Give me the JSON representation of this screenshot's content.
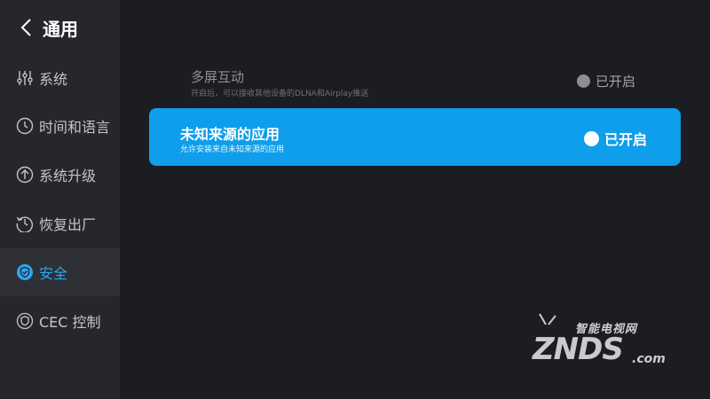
{
  "header": {
    "title": "通用"
  },
  "sidebar": {
    "items": [
      {
        "label": "系统",
        "icon": "sliders-icon"
      },
      {
        "label": "时间和语言",
        "icon": "clock-icon"
      },
      {
        "label": "系统升级",
        "icon": "upload-icon"
      },
      {
        "label": "恢复出厂",
        "icon": "restore-icon"
      },
      {
        "label": "安全",
        "icon": "shield-icon",
        "active": true
      },
      {
        "label": "CEC 控制",
        "icon": "cec-icon"
      }
    ]
  },
  "settings": [
    {
      "title": "多屏互动",
      "description": "开启后，可以接收其他设备的DLNA和Airplay推送",
      "status": "已开启",
      "focused": false
    },
    {
      "title": "未知来源的应用",
      "description": "允许安装来自未知来源的应用",
      "status": "已开启",
      "focused": true
    }
  ],
  "watermark": {
    "tagline": "智能电视网",
    "brand": "ZNDS",
    "suffix": ".com"
  },
  "colors": {
    "accent": "#0f9eeb",
    "active_text": "#2ca6f0",
    "background": "#1c1d22",
    "sidebar": "#26272c"
  }
}
